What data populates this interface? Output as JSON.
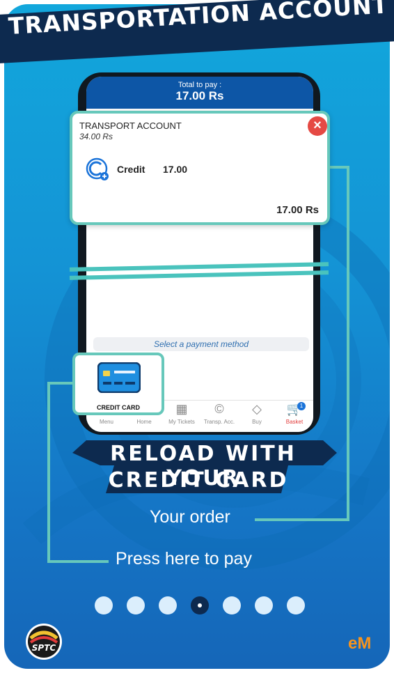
{
  "title": "TRANSPORTATION ACCOUNT",
  "payment_screen": {
    "total_label": "Total to pay :",
    "total_amount": "17.00 Rs",
    "select_payment": "Select a payment method"
  },
  "transport_account": {
    "title": "TRANSPORT ACCOUNT",
    "balance": "34.00 Rs",
    "close_icon": "close-icon",
    "credit_label": "Credit",
    "credit_value": "17.00",
    "total": "17.00 Rs"
  },
  "credit_card_tile": {
    "label": "CREDIT CARD",
    "icon": "credit-card-icon"
  },
  "tabbar": [
    {
      "label": "Menu",
      "icon": "menu-icon"
    },
    {
      "label": "Home",
      "icon": "home-icon"
    },
    {
      "label": "My Tickets",
      "icon": "qr-icon"
    },
    {
      "label": "Transp. Acc.",
      "icon": "copyright-icon"
    },
    {
      "label": "Buy",
      "icon": "tag-icon"
    },
    {
      "label": "Basket",
      "icon": "cart-icon",
      "badge": "1"
    }
  ],
  "banner": {
    "line1": "RELOAD WITH YOUR",
    "line2": "CREDIT CARD"
  },
  "callouts": {
    "order": "Your order",
    "press_prefix": "Press ",
    "press_here": "here",
    "press_suffix": " to pay"
  },
  "pagination": {
    "total": 7,
    "active_index": 3
  },
  "logos": {
    "left": "SPTC",
    "right": "eM"
  },
  "colors": {
    "accent_teal": "#67c8bb",
    "navy": "#0d2a4f",
    "active_tab": "#e2403f",
    "em_orange": "#f7941d"
  }
}
